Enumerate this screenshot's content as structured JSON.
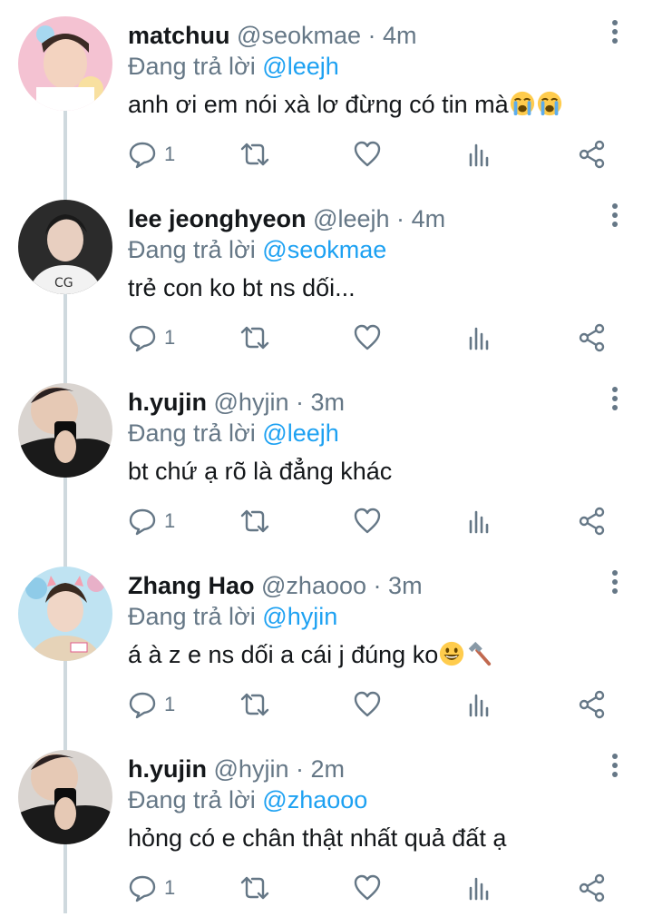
{
  "replying_prefix": "Đang trả lời",
  "tweets": [
    {
      "name": "matchuu",
      "handle": "@seokmae",
      "time": "4m",
      "reply_to": "@leejh",
      "text": "anh ơi em nói xà lơ đừng có tin mà",
      "emojis": [
        "crying-emoji",
        "crying-emoji"
      ],
      "reply_count": "1"
    },
    {
      "name": "lee jeonghyeon",
      "handle": "@leejh",
      "time": "4m",
      "reply_to": "@seokmae",
      "text": "trẻ con ko bt ns dối...",
      "emojis": [],
      "reply_count": "1"
    },
    {
      "name": "h.yujin",
      "handle": "@hyjin",
      "time": "3m",
      "reply_to": "@leejh",
      "text": "bt chứ ạ rõ là đẳng khác",
      "emojis": [],
      "reply_count": "1"
    },
    {
      "name": "Zhang Hao",
      "handle": "@zhaooo",
      "time": "3m",
      "reply_to": "@hyjin",
      "text": "á à z e ns dối a cái j đúng ko",
      "emojis": [
        "grinning-emoji",
        "hammer-emoji"
      ],
      "reply_count": "1"
    },
    {
      "name": "h.yujin",
      "handle": "@hyjin",
      "time": "2m",
      "reply_to": "@zhaooo",
      "text": "hỏng có e chân thật nhất quả đất ạ",
      "emojis": [],
      "reply_count": "1"
    }
  ],
  "colors": {
    "accent": "#1da1f2",
    "secondary_text": "#657786",
    "thread_line": "#cfd9de"
  }
}
